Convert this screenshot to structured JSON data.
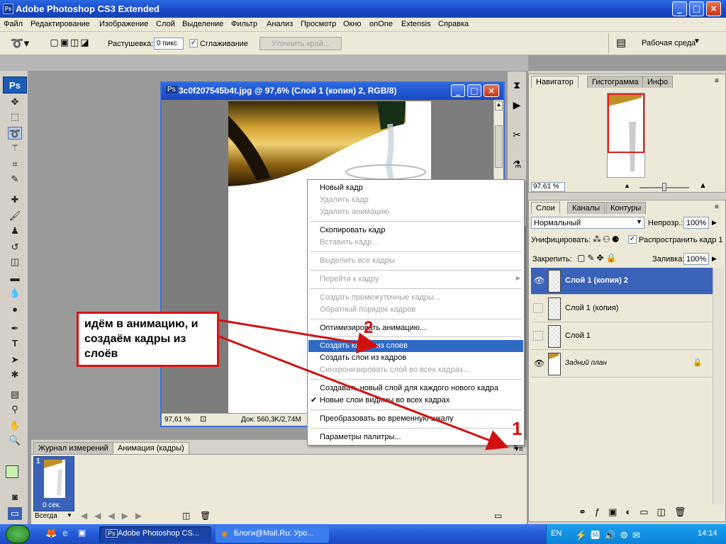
{
  "window": {
    "title": "Adobe Photoshop CS3 Extended",
    "logo": "Ps",
    "buttons": [
      "_",
      "□",
      "×"
    ]
  },
  "menu": [
    "Файл",
    "Редактирование",
    "Изображение",
    "Слой",
    "Выделение",
    "Фильтр",
    "Анализ",
    "Просмотр",
    "Окно",
    "onOne",
    "Extensis",
    "Справка"
  ],
  "options": {
    "feather_label": "Растушевка:",
    "feather_value": "0 пикс",
    "antialias_label": "Сглаживание",
    "refine_button": "Уточнить край...",
    "workspace_label": "Рабочая среда"
  },
  "toolbox": {
    "logo": "Ps"
  },
  "document": {
    "title": "3c0f207545b4t.jpg @ 97,6% (Слой 1 (копия) 2, RGB/8)",
    "zoom": "97,61 %",
    "doc_info": "Док: 560,3K/2,74M"
  },
  "context_menu": {
    "items": [
      {
        "label": "Новый кадр",
        "disabled": false
      },
      {
        "label": "Удалить кадр",
        "disabled": true
      },
      {
        "label": "Удалить анимацию",
        "disabled": true
      },
      {
        "label": "Скопировать кадр",
        "disabled": false
      },
      {
        "label": "Вставить кадр...",
        "disabled": true
      },
      {
        "label": "Выделить все кадры",
        "disabled": true
      },
      {
        "label": "Перейти к кадру",
        "disabled": true
      },
      {
        "label": "Создать промежуточные кадры...",
        "disabled": true
      },
      {
        "label": "Обратный порядок кадров",
        "disabled": true
      },
      {
        "label": "Оптимизировать анимацию...",
        "disabled": false
      },
      {
        "label": "Создать кадры из слоев",
        "disabled": false,
        "highlighted": true
      },
      {
        "label": "Создать слои из кадров",
        "disabled": false
      },
      {
        "label": "Синхронизировать слой во всех кадрах...",
        "disabled": true
      },
      {
        "label": "Создавать новый слой для каждого нового кадра",
        "disabled": false
      },
      {
        "label": "Новые слои видимы во всех кадрах",
        "disabled": false,
        "checked": true
      },
      {
        "label": "Преобразовать во временную шкалу",
        "disabled": false
      },
      {
        "label": "Параметры палитры...",
        "disabled": false
      }
    ]
  },
  "annotation": {
    "text": "идём в анимацию, и создаём кадры из слоёв",
    "marker_1": "1",
    "marker_2": "2",
    "color": "#d11111"
  },
  "anim_panel": {
    "tabs": [
      "Журнал измерений",
      "Анимация (кадры)"
    ],
    "frame_number": "1",
    "frame_delay": "0 сек.",
    "loop": "Всегда"
  },
  "navigator": {
    "tabs": [
      "Навигатор",
      "Гистограмма",
      "Инфо"
    ],
    "zoom": "97.61 %"
  },
  "layers": {
    "tabs": [
      "Слои",
      "Каналы",
      "Контуры"
    ],
    "blend_mode": "Нормальный",
    "opacity_label": "Непрозр.:",
    "opacity": "100%",
    "unify_label": "Унифицировать:",
    "propagate_label": "Распространить кадр 1",
    "lock_label": "Закрепить:",
    "fill_label": "Заливка:",
    "fill": "100%",
    "items": [
      "Слой 1 (копия) 2",
      "Слой 1 (копия)",
      "Слой 1",
      "Задний план"
    ]
  },
  "taskbar": {
    "task1": "Adobe Photoshop CS...",
    "task2": "Блоги@Mail.Ru: Уро...",
    "lang": "EN",
    "time": "14:14"
  }
}
